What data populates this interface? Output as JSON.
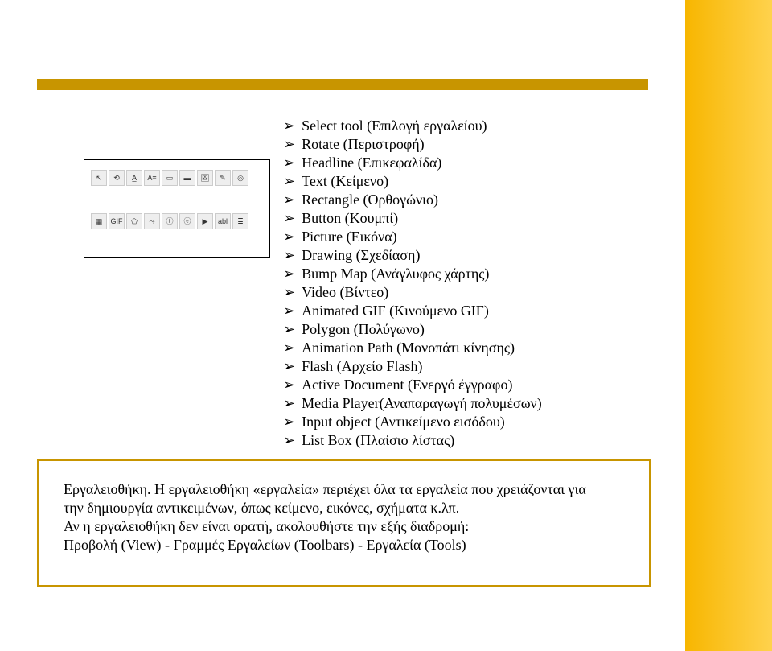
{
  "list": {
    "items": [
      "Select tool (Επιλογή εργαλείου)",
      "Rotate (Περιστροφή)",
      "Headline (Επικεφαλίδα)",
      "Text (Κείμενο)",
      "Rectangle (Ορθογώνιο)",
      "Button (Κουμπί)",
      "Picture (Εικόνα)",
      "Drawing (Σχεδίαση)",
      "Bump Map (Ανάγλυφος χάρτης)",
      "Video (Βίντεο)",
      "Animated GIF (Κινούμενο GIF)",
      "Polygon (Πολύγωνο)",
      "Animation Path (Μονοπάτι κίνησης)",
      "Flash (Αρχείο Flash)",
      "Active Document (Ενεργό έγγραφο)",
      "Media Player(Αναπαραγωγή πολυμέσων)",
      "Input object (Αντικείμενο εισόδου)",
      "List Box (Πλαίσιο λίστας)"
    ]
  },
  "callout": {
    "l1": "Εργαλειοθήκη. Η εργαλειοθήκη «εργαλεία» περιέχει όλα τα εργαλεία που χρειάζονται για",
    "l2": "την δημιουργία αντικειμένων, όπως κείμενο, εικόνες, σχήματα κ.λπ.",
    "l3": "Αν η εργαλειοθήκη δεν είναι ορατή, ακολουθήστε την εξής διαδρομή:",
    "l4": "Προβολή (View) - Γραμμές Εργαλείων (Toolbars) - Εργαλεία (Tools)"
  },
  "icons_row1": [
    "↖",
    "⟲",
    "A̲",
    "A≡",
    "▭",
    "▬",
    "🖼",
    "✎",
    "◎"
  ],
  "icons_row2": [
    "▦",
    "GIF",
    "⬠",
    "⤳",
    "ⓕ",
    "ⓔ",
    "▶",
    "abl",
    "≣"
  ]
}
